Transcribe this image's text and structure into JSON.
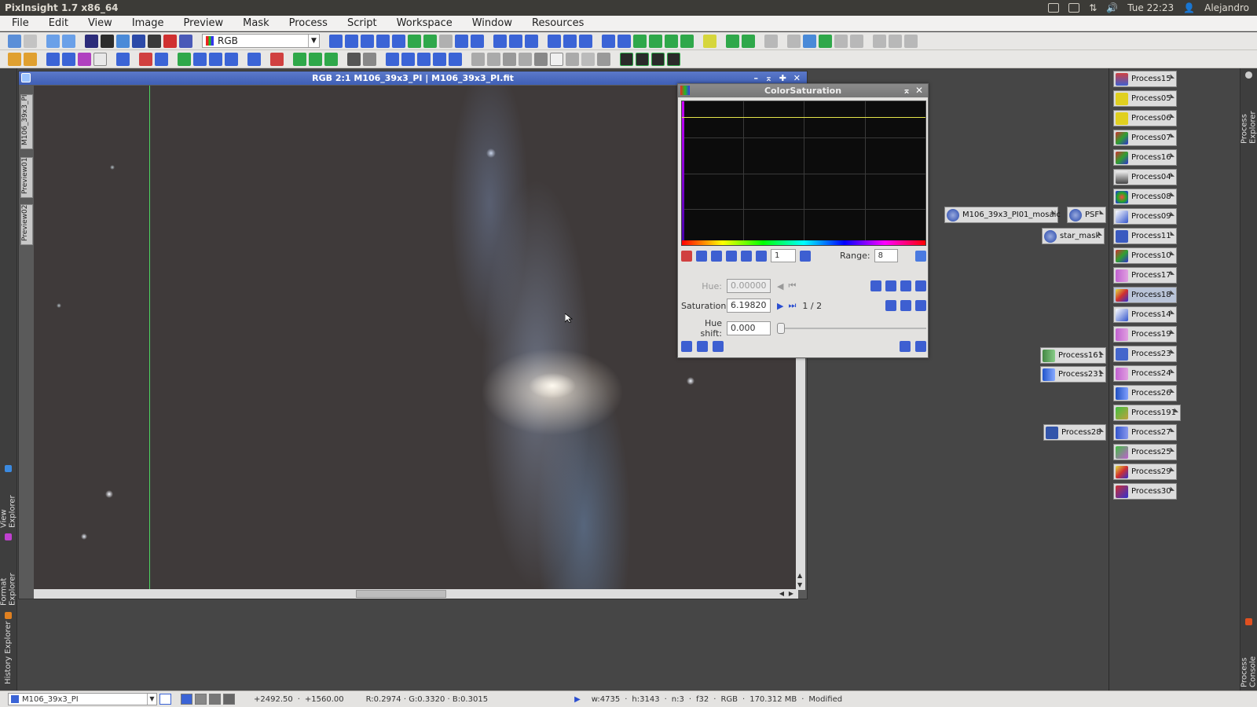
{
  "app": {
    "title": "PixInsight 1.7 x86_64",
    "clock": "Tue 22:23",
    "user": "Alejandro"
  },
  "menu": [
    "File",
    "Edit",
    "View",
    "Image",
    "Preview",
    "Mask",
    "Process",
    "Script",
    "Workspace",
    "Window",
    "Resources"
  ],
  "toolbar": {
    "color_space": "RGB"
  },
  "image_window": {
    "title": "RGB 2:1 M106_39x3_PI | M106_39x3_PI.fit",
    "tabs": [
      "M106_39x3_PI",
      "Preview01",
      "Preview02"
    ]
  },
  "color_saturation": {
    "title": "ColorSaturation",
    "point_index": "1",
    "range_label": "Range:",
    "range_value": "8",
    "hue_label": "Hue:",
    "hue_value": "0.00000",
    "saturation_label": "Saturation:",
    "saturation_value": "6.19820",
    "point_count": "1 / 2",
    "hue_shift_label": "Hue shift:",
    "hue_shift_value": "0.000"
  },
  "floating_icons": {
    "mosaic": "M106_39x3_PI01_mosaic",
    "psf": "PSF",
    "star_mask": "star_mask",
    "p161": "Process161",
    "p231": "Process231",
    "p28": "Process28"
  },
  "process_list": [
    "Process15",
    "Process05",
    "Process06",
    "Process07",
    "Process16",
    "Process04",
    "Process08",
    "Process09",
    "Process11",
    "Process10",
    "Process17",
    "Process18",
    "Process14",
    "Process19",
    "Process23",
    "Process24",
    "Process26",
    "Process191",
    "Process27",
    "Process25",
    "Process29",
    "Process30"
  ],
  "process_list_selected": "Process18",
  "side_tabs": {
    "left": [
      "View Explorer",
      "Format Explorer",
      "History Explorer"
    ],
    "right": [
      "Process Explorer",
      "Process Console"
    ]
  },
  "statusbar": {
    "view": "M106_39x3_PI",
    "x": "+2492.50",
    "y": "+1560.00",
    "rgb": "R:0.2974 · G:0.3320 · B:0.3015",
    "width": "w:4735",
    "height": "h:3143",
    "channels": "n:3",
    "sample": "f32",
    "space": "RGB",
    "memory": "170.312 MB",
    "state": "Modified"
  }
}
